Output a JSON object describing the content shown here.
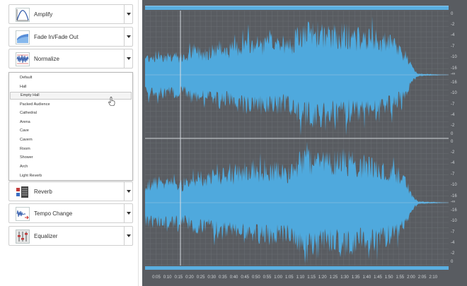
{
  "effects": {
    "top": [
      {
        "label": "Amplify",
        "icon": "amplify-icon"
      },
      {
        "label": "Fade In/Fade Out",
        "icon": "fade-icon"
      },
      {
        "label": "Normalize",
        "icon": "normalize-icon"
      }
    ],
    "bottom": [
      {
        "label": "Reverb",
        "icon": "reverb-icon"
      },
      {
        "label": "Tempo Change",
        "icon": "tempo-icon"
      },
      {
        "label": "Equalizer",
        "icon": "equalizer-icon"
      }
    ]
  },
  "presets": {
    "items": [
      "Default",
      "Hall",
      "Empty Hall",
      "Packed Audience",
      "Cathedral",
      "Arena",
      "Cave",
      "Cavern",
      "Room",
      "Shower",
      "Arch",
      "Light Reverb"
    ],
    "hovered": "Empty Hall"
  },
  "db_scale": [
    "0",
    "-2",
    "-4",
    "-7",
    "-10",
    "-16",
    "-∞",
    "-16",
    "-10",
    "-7",
    "-4",
    "-2",
    "0"
  ],
  "time_labels": [
    "0:05",
    "0:10",
    "0:15",
    "0:20",
    "0:25",
    "0:30",
    "0:35",
    "0:40",
    "0:45",
    "0:50",
    "0:55",
    "1:00",
    "1:05",
    "1:10",
    "1:15",
    "1:20",
    "1:25",
    "1:30",
    "1:35",
    "1:40",
    "1:45",
    "1:50",
    "1:55",
    "2:00",
    "2:05",
    "2:10"
  ],
  "colors": {
    "waveform": "#4fa9dd",
    "background": "#595c61",
    "grid": "#6a6e73",
    "accent": "#5aaee0"
  }
}
